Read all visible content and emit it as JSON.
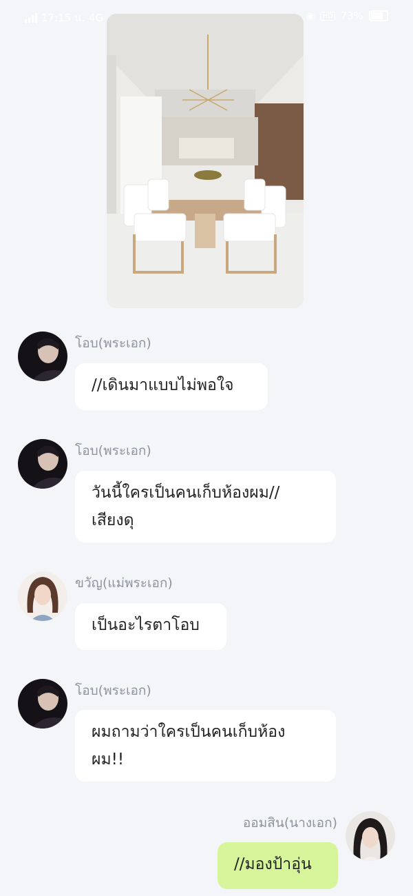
{
  "status_bar": {
    "time": "17:15 น.",
    "extra": "4G",
    "battery_text": "73%",
    "hd": "HD"
  },
  "messages": [
    {
      "type": "image",
      "alt_icon": "dining-room-photo"
    },
    {
      "sender": "โอบ(พระเอก)",
      "lines": [
        "//เดินมาแบบไม่พอใจ"
      ]
    },
    {
      "sender": "โอบ(พระเอก)",
      "lines": [
        "วันนี้ใครเป็นคนเก็บห้องผม//",
        "เสียงดุ"
      ]
    },
    {
      "sender": "ขวัญ(แม่พระเอก)",
      "lines": [
        "เป็นอะไรตาโอบ"
      ]
    },
    {
      "sender": "โอบ(พระเอก)",
      "lines": [
        "ผมถามว่าใครเป็นคนเก็บห้อง",
        "ผม!!"
      ]
    },
    {
      "sender": "ออมสิน(นางเอก)",
      "lines": [
        "//มองป้าอุ่น"
      ],
      "is_me": true
    }
  ],
  "colors": {
    "background": "#f4f5f9",
    "bubble_other": "#ffffff",
    "bubble_me": "#d6f59a",
    "name_text": "#8f939b"
  }
}
